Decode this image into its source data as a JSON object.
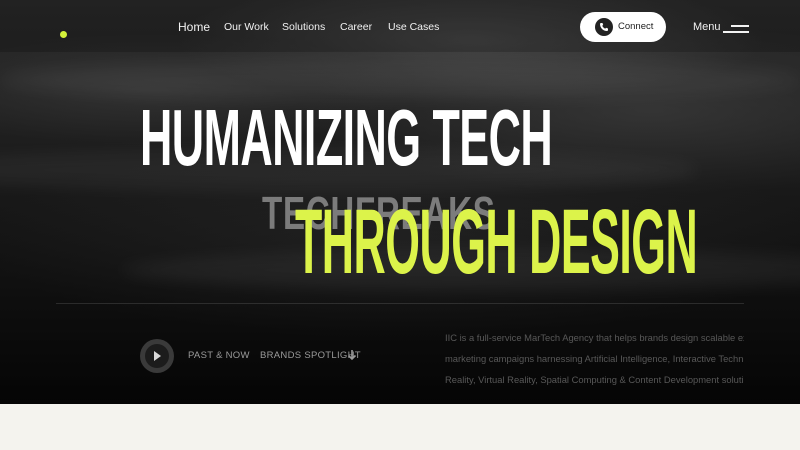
{
  "nav": {
    "items": [
      {
        "label": "Home"
      },
      {
        "label": "Our Work"
      },
      {
        "label": "Solutions"
      },
      {
        "label": "Career"
      },
      {
        "label": "Use Cases"
      }
    ],
    "connect_label": "Connect",
    "menu_label": "Menu"
  },
  "hero": {
    "line1": "HUMANIZING TECH",
    "ghost": "TECHFREAKS",
    "line2": "THROUGH DESIGN"
  },
  "links": {
    "past_now": "PAST & NOW",
    "brands": "BRANDS SPOTLIGHT"
  },
  "description": {
    "lines": [
      "IIC is a full-service MarTech Agency that helps brands design scalable exp",
      "marketing campaigns harnessing Artificial Intelligence, Interactive Techn",
      "Reality, Virtual Reality, Spatial Computing & Content Development solutio"
    ]
  },
  "colors": {
    "accent": "#dcf34a",
    "background": "#111111",
    "footer": "#f4f3ee"
  },
  "icons": [
    "phone-icon",
    "menu-icon",
    "play-icon",
    "arrow-down-icon"
  ]
}
